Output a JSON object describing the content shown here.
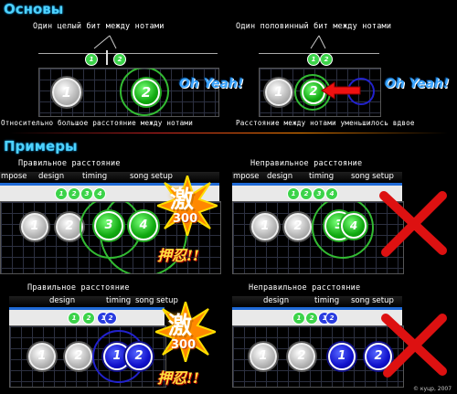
{
  "basics": {
    "heading": "Основы",
    "left_caption": "Один целый бит между нотами",
    "right_caption": "Один половинный бит между нотами",
    "left_bottom": "Относительно большое расстояние между нотами",
    "right_bottom": "Расстояние между нотами уменьшилось вдвое",
    "feedback": "Oh Yeah!",
    "left_markers": [
      "1",
      "2"
    ],
    "right_markers": [
      "1",
      "2"
    ],
    "left_notes": [
      "1",
      "2"
    ],
    "right_notes": [
      "1",
      "2"
    ]
  },
  "examples": {
    "heading": "Примеры",
    "menu": {
      "tab1": "mpose",
      "tab2": "design",
      "tab3": "timing",
      "tab4": "song setup"
    },
    "menu_short": {
      "tab2": "design",
      "tab3": "timing",
      "tab4": "song setup"
    },
    "row1": {
      "left_caption": "Правильное расстояние",
      "right_caption": "Неправильное расстояние",
      "markers": [
        "1",
        "2",
        "3",
        "4"
      ],
      "notes": [
        "1",
        "2",
        "3",
        "4"
      ]
    },
    "row2": {
      "left_caption": "Правильное расстояние",
      "right_caption": "Неправильное расстояние",
      "markers": [
        "1",
        "2",
        "1",
        "2"
      ],
      "notes": [
        "1",
        "2",
        "1",
        "2"
      ]
    },
    "burst_kanji": "激",
    "burst_score": "300",
    "oshi": "押忍!!"
  },
  "copyright": "© куцр, 2007",
  "colors": {
    "heading": "#4fd2ff",
    "green": "#22aa22",
    "blue": "#1111cc",
    "x_red": "#dd1111"
  }
}
